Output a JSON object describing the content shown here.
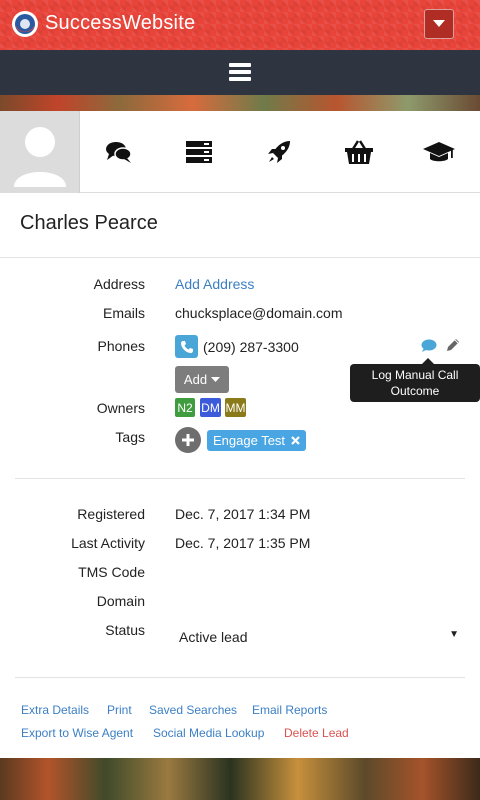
{
  "app": {
    "brand": "SuccessWebsite"
  },
  "contact": {
    "name": "Charles Pearce"
  },
  "labels": {
    "address": "Address",
    "emails": "Emails",
    "phones": "Phones",
    "owners": "Owners",
    "tags": "Tags",
    "registered": "Registered",
    "last_activity": "Last Activity",
    "tms_code": "TMS Code",
    "domain": "Domain",
    "status": "Status"
  },
  "values": {
    "add_address": "Add Address",
    "email": "chucksplace@domain.com",
    "phone": "(209) 287-3300",
    "add_button": "Add",
    "owners": [
      "N2",
      "DM",
      "MM"
    ],
    "tag": "Engage Test",
    "registered": "Dec. 7, 2017 1:34 PM",
    "last_activity": "Dec. 7, 2017 1:35 PM",
    "tms_code": "",
    "domain": "",
    "status": "Active lead"
  },
  "tooltip": {
    "line1": "Log Manual Call",
    "line2": "Outcome"
  },
  "footer": {
    "links_row1": [
      "Extra Details",
      "Print",
      "Saved Searches",
      "Email Reports"
    ],
    "links_row2": [
      "Export to Wise Agent",
      "Social Media Lookup",
      "Delete Lead"
    ]
  },
  "icons": {
    "logo": "logo-icon",
    "menu_caret": "caret-down-icon",
    "hamburger": "hamburger-icon",
    "toolbar": [
      "chat-icon",
      "server-icon",
      "rocket-icon",
      "basket-icon",
      "graduation-cap-icon"
    ],
    "phone": "phone-icon",
    "comment": "comment-icon",
    "edit": "pencil-icon",
    "plus": "plus-icon",
    "tag_remove": "close-icon"
  },
  "colors": {
    "brand": "#e8443a",
    "navbar": "#2e3440",
    "link": "#3b7fc4",
    "danger": "#d9534f",
    "owner_n2": "#3f9d3f",
    "owner_dm": "#3b5bdb",
    "owner_mm": "#8a7a1a",
    "tag": "#4aa6e3"
  }
}
